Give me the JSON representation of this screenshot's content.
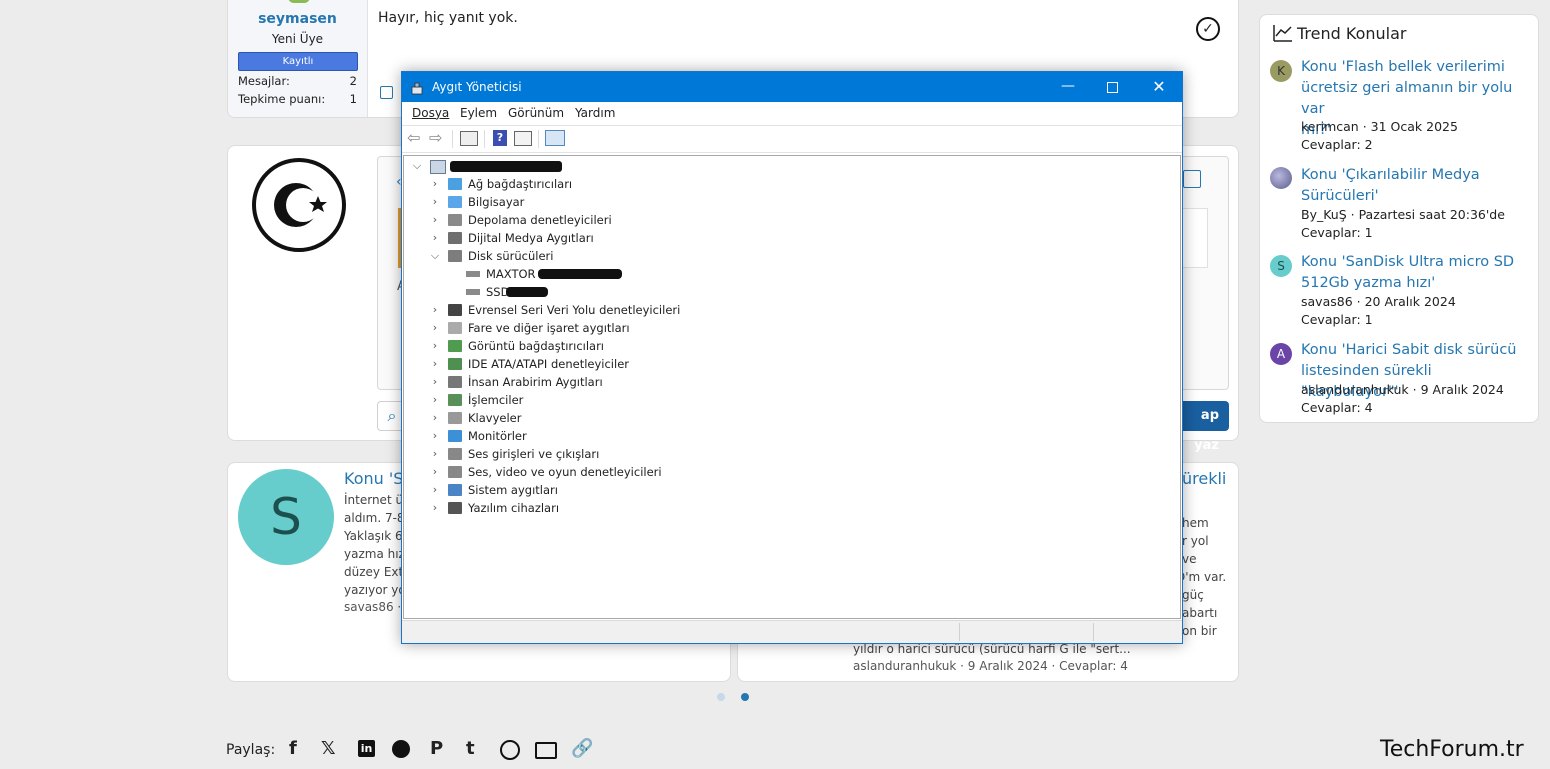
{
  "forum": {
    "post1": {
      "username": "seymasen",
      "user_title": "Yeni Üye",
      "badge": "Kayıtlı",
      "messages_label": "Mesajlar:",
      "messages_value": "2",
      "reaction_label": "Tepkime puanı:",
      "reaction_value": "1",
      "text": "Hayır, hiç yanıt yok."
    },
    "reply": {
      "button_text": "ap yaz"
    },
    "similar": {
      "left": {
        "avatar_letter": "S",
        "title": "Konu 'S",
        "lines": [
          "İnternet üz",
          "aldım. 7-8",
          "Yaklaşık 6",
          "yazma hız",
          "düzey Ext",
          "yazıyor yo"
        ],
        "meta": "savas86 · 2"
      },
      "right": {
        "title_tail": "ürekli",
        "lines_tail": [
          "hem",
          "r yol",
          "ve",
          "D'm var.",
          "güç",
          "abartı",
          "on bir"
        ],
        "line_full": "yıldır o harici sürücü (sürücü harfi G ile \"sert...",
        "meta": "aslanduranhukuk · 9 Aralık 2024 · Cevaplar: 4"
      }
    },
    "share": {
      "label": "Paylaş:",
      "icons": [
        "facebook-icon",
        "x-icon",
        "linkedin-icon",
        "reddit-icon",
        "pinterest-icon",
        "tumblr-icon",
        "whatsapp-icon",
        "email-icon",
        "link-icon"
      ]
    },
    "brand": "TechForum.tr",
    "colors": {
      "link": "#2577b1",
      "accent": "#1a5fa0",
      "badge": "#4a7ae0",
      "avatar_s": "#66cccc"
    }
  },
  "trend": {
    "title": "Trend Konular",
    "items": [
      {
        "avatar": "K",
        "avatar_color": "#9a9a63",
        "title": "Konu 'Flash bellek verilerimi ücretsiz geri almanın bir yolu var mı?'",
        "line1": "Konu 'Flash bellek verilerimi",
        "line2": "ücretsiz geri almanın bir yolu var",
        "line3": "mı?'",
        "meta": "kerimcan · 31 Ocak 2025",
        "replies": "Cevaplar: 2"
      },
      {
        "avatar": "",
        "avatar_color": "#6a6a9a",
        "line1": "Konu 'Çıkarılabilir Medya",
        "line2": "Sürücüleri'",
        "line3": "",
        "meta": "By_KuŞ · Pazartesi saat 20:36'de",
        "replies": "Cevaplar: 1"
      },
      {
        "avatar": "S",
        "avatar_color": "#66cccc",
        "line1": "Konu 'SanDisk Ultra micro SD",
        "line2": "512Gb yazma hızı'",
        "line3": "",
        "meta": "savas86 · 20 Aralık 2024",
        "replies": "Cevaplar: 1"
      },
      {
        "avatar": "A",
        "avatar_color": "#6b44a8",
        "line1": "Konu 'Harici Sabit disk sürücü",
        "line2": "listesinden sürekli \"kayboluyor\"'",
        "line3": "",
        "meta": "aslanduranhukuk · 9 Aralık 2024",
        "replies": "Cevaplar: 4"
      }
    ]
  },
  "device_manager": {
    "title": "Aygıt Yöneticisi",
    "menu": [
      "Dosya",
      "Eylem",
      "Görünüm",
      "Yardım"
    ],
    "tree": [
      {
        "label": "Ağ bağdaştırıcıları",
        "icon": "network-adapter-icon",
        "expanded": false
      },
      {
        "label": "Bilgisayar",
        "icon": "computer-icon",
        "expanded": false
      },
      {
        "label": "Depolama denetleyicileri",
        "icon": "storage-controller-icon",
        "expanded": false
      },
      {
        "label": "Dijital Medya Aygıtları",
        "icon": "media-device-icon",
        "expanded": false
      },
      {
        "label": "Disk sürücüleri",
        "icon": "disk-drive-icon",
        "expanded": true,
        "children": [
          "MAXTOR S",
          "SSD"
        ]
      },
      {
        "label": "Evrensel Seri Veri Yolu denetleyicileri",
        "icon": "usb-icon",
        "expanded": false
      },
      {
        "label": "Fare ve diğer işaret aygıtları",
        "icon": "mouse-icon",
        "expanded": false
      },
      {
        "label": "Görüntü bağdaştırıcıları",
        "icon": "display-adapter-icon",
        "expanded": false
      },
      {
        "label": "IDE ATA/ATAPI denetleyiciler",
        "icon": "ide-icon",
        "expanded": false
      },
      {
        "label": "İnsan Arabirim Aygıtları",
        "icon": "hid-icon",
        "expanded": false
      },
      {
        "label": "İşlemciler",
        "icon": "processor-icon",
        "expanded": false
      },
      {
        "label": "Klavyeler",
        "icon": "keyboard-icon",
        "expanded": false
      },
      {
        "label": "Monitörler",
        "icon": "monitor-icon",
        "expanded": false
      },
      {
        "label": "Ses girişleri ve çıkışları",
        "icon": "speaker-icon",
        "expanded": false
      },
      {
        "label": "Ses, video ve oyun denetleyicileri",
        "icon": "sound-controller-icon",
        "expanded": false
      },
      {
        "label": "Sistem aygıtları",
        "icon": "system-device-icon",
        "expanded": false
      },
      {
        "label": "Yazılım cihazları",
        "icon": "software-device-icon",
        "expanded": false
      }
    ]
  }
}
